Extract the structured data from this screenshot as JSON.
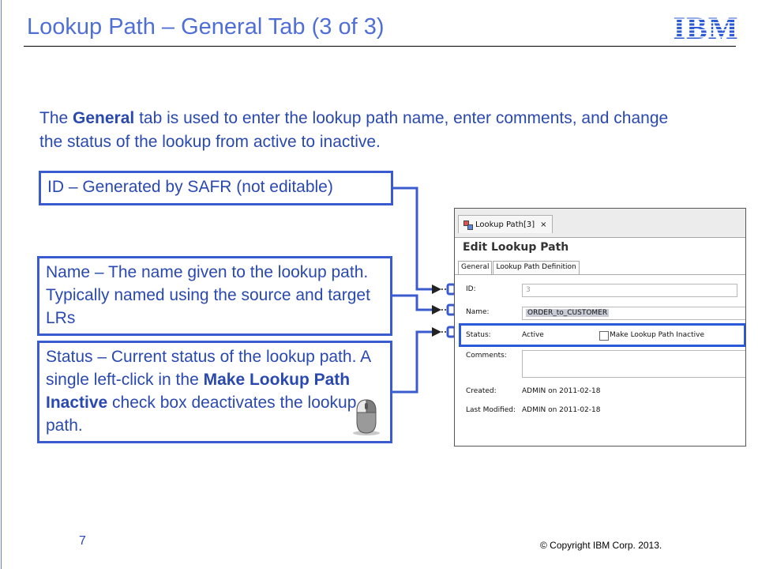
{
  "slide": {
    "title": "Lookup Path – General Tab (3 of 3)",
    "logo_text": "IBM",
    "page_number": "7",
    "copyright": "© Copyright IBM Corp. 2013."
  },
  "intro": {
    "part1": "The ",
    "bold": "General",
    "part2": " tab is used to enter the lookup path name, enter comments, and change the status of the lookup from active to inactive."
  },
  "callouts": {
    "id_text": "ID – Generated by SAFR (not editable)",
    "name_text": "Name – The name given to the lookup path. Typically named using the source and target LRs",
    "status_part1": "Status – Current status of the lookup path. A single left-click in the ",
    "status_bold": "Make Lookup Path Inactive",
    "status_part2": " check box deactivates the lookup path."
  },
  "screenshot": {
    "editor_tab_label": "Lookup Path[3]",
    "editor_tab_close": "×",
    "heading": "Edit Lookup Path",
    "subtabs": [
      "General",
      "Lookup Path Definition"
    ],
    "id_label": "ID:",
    "id_value": "3",
    "name_label": "Name:",
    "name_value": "ORDER_to_CUSTOMER",
    "status_label": "Status:",
    "status_value": "Active",
    "inactive_checkbox_label": "Make Lookup Path Inactive",
    "comments_label": "Comments:",
    "created_label": "Created:",
    "created_value": "ADMIN on 2011-02-18",
    "modified_label": "Last Modified:",
    "modified_value": "ADMIN on 2011-02-18"
  },
  "colors": {
    "accent": "#4f6fd6",
    "callout_border": "#3a5bd0",
    "highlight": "#2a5ad8"
  }
}
